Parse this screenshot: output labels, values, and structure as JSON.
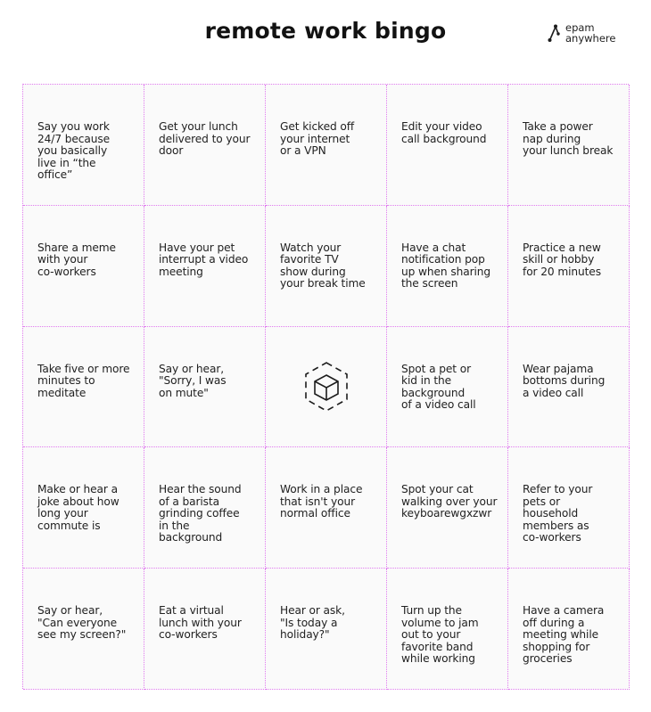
{
  "title": "remote work bingo",
  "logo": {
    "icon": "epam-anywhere-logo-icon",
    "line1": "epam",
    "line2": "anywhere"
  },
  "colors": {
    "grid_line": "#e07bef",
    "cell_background": "#fafafa",
    "text": "#222222"
  },
  "board": {
    "rows": [
      [
        {
          "text": "Say you work\n24/7 because\nyou basically\nlive in “the\noffice”"
        },
        {
          "text": "Get your lunch\ndelivered to your\ndoor"
        },
        {
          "text": "Get kicked off\nyour internet\nor a VPN"
        },
        {
          "text": "Edit your video\ncall background"
        },
        {
          "text": "Take a power\nnap during\nyour lunch break"
        }
      ],
      [
        {
          "text": "Share a meme\nwith your\nco-workers"
        },
        {
          "text": "Have your pet\ninterrupt a video\nmeeting"
        },
        {
          "text": "Watch your\nfavorite TV\nshow during\nyour break time"
        },
        {
          "text": "Have a chat\nnotification pop\nup when sharing\nthe screen"
        },
        {
          "text": "Practice a new\nskill or hobby\nfor 20 minutes"
        }
      ],
      [
        {
          "text": "Take five or more\nminutes to\nmeditate"
        },
        {
          "text": "Say or hear,\n\"Sorry, I was\non mute\""
        },
        {
          "text": "",
          "icon": "cube-free-space-icon"
        },
        {
          "text": "Spot a pet or\nkid in the\nbackground\nof a video call"
        },
        {
          "text": "Wear pajama\nbottoms during\na video call"
        }
      ],
      [
        {
          "text": "Make or hear a\njoke about how\nlong your\ncommute is"
        },
        {
          "text": "Hear the sound\nof a barista\ngrinding coffee\nin the\nbackground"
        },
        {
          "text": "Work in a place\nthat isn't your\nnormal office"
        },
        {
          "text": "Spot your cat\nwalking over your\nkeyboarewgxzwr"
        },
        {
          "text": "Refer to your\npets or\nhousehold\nmembers as\nco-workers"
        }
      ],
      [
        {
          "text": "Say or hear,\n\"Can everyone\nsee my screen?\""
        },
        {
          "text": "Eat a virtual\nlunch with your\nco-workers"
        },
        {
          "text": "Hear or ask,\n\"Is today a\nholiday?\""
        },
        {
          "text": "Turn up the\nvolume to jam\nout to your\nfavorite band\nwhile working"
        },
        {
          "text": "Have a camera\noff during a\nmeeting while\nshopping for\ngroceries"
        }
      ]
    ]
  }
}
